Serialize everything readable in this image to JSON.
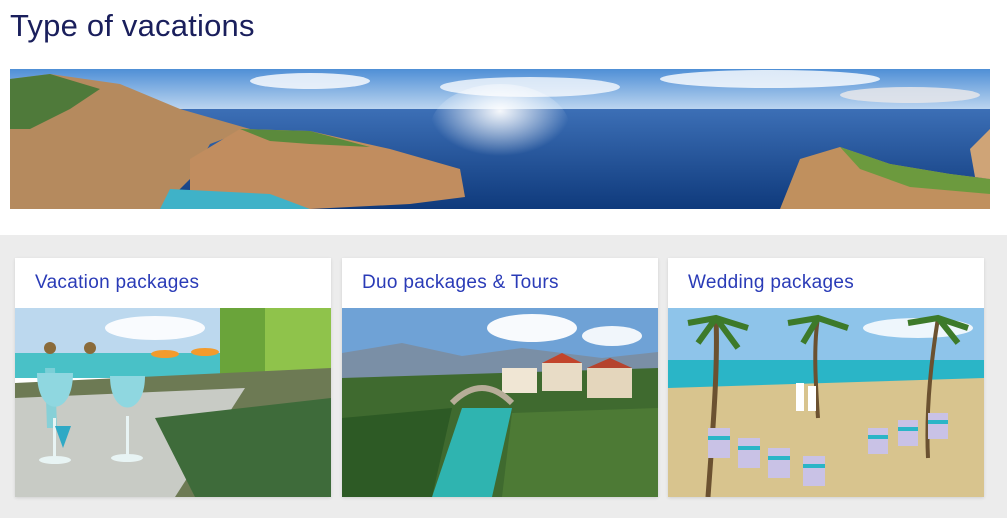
{
  "page": {
    "title": "Type of vacations"
  },
  "hero": {
    "image": "coastal-bay-panorama"
  },
  "cards": [
    {
      "title": "Vacation packages",
      "image": "poolside-cocktails"
    },
    {
      "title": "Duo packages & Tours",
      "image": "river-town-bridge"
    },
    {
      "title": "Wedding packages",
      "image": "beach-wedding-setup"
    }
  ],
  "colors": {
    "title_text": "#1a1f5c",
    "card_title_text": "#2a3bb7",
    "cards_background": "#ececec"
  }
}
